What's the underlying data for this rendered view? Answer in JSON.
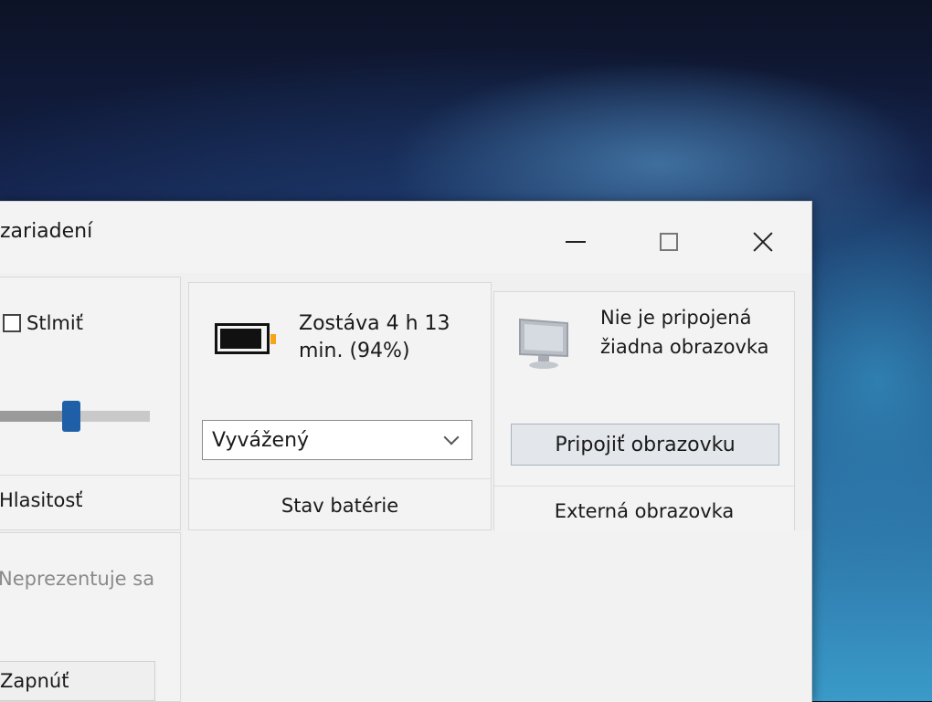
{
  "window": {
    "title": "zariadení",
    "controls": {
      "minimize": "minimize",
      "maximize": "maximize",
      "close": "close"
    }
  },
  "brightness_tile": {
    "dim_checkbox_label": "Stlmiť",
    "dim_checked": false,
    "volume_level_fraction": 0.48,
    "caption": "Hlasitosť"
  },
  "battery_tile": {
    "status_text": "Zostáva 4 h 13 min. (94%)",
    "charge_percent": 94,
    "power_plan": "Vyvážený",
    "caption": "Stav batérie"
  },
  "display_tile": {
    "status_text": "Nie je pripojená žiadna obrazovka",
    "connect_button_label": "Pripojiť obrazovku",
    "caption": "Externá obrazovka"
  },
  "presentation_tile": {
    "status_text": "Neprezentuje sa",
    "enable_button_label": "Zapnúť"
  },
  "colors": {
    "accent": "#1f5fa8",
    "battery_tip": "#f6a516"
  }
}
